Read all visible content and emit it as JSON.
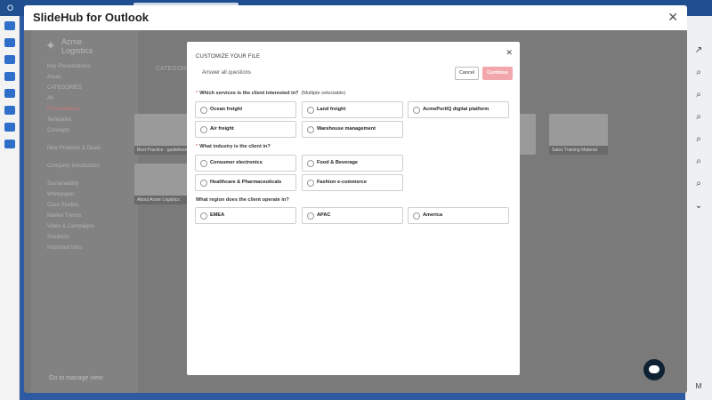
{
  "outlook": {
    "app_letter": "O"
  },
  "window": {
    "title": "SlideHub for Outlook"
  },
  "background": {
    "logo_line1": "Acme",
    "logo_line2": "Logistics",
    "categories_label": "CATEGORIES",
    "manage_view": "Go to manage view",
    "nav": [
      "Key Presentations",
      "Areas",
      "CATEGORIES",
      "All",
      "Presentations",
      "Templates",
      "Concepts",
      "New Products & Deals",
      "Company Introduction",
      "Sustainability",
      "Whitepaper",
      "Case Studies",
      "Market Trends",
      "Video & Campaigns",
      "Solutions",
      "Important links"
    ],
    "cards": [
      "Best Practice - guidelines",
      "About Acme Logistics",
      "Sales Training Material"
    ]
  },
  "modal": {
    "title": "CUSTOMIZE YOUR FILE",
    "answer_all": "Answer all questions",
    "cancel_label": "Cancel",
    "continue_label": "Continue",
    "q1": {
      "text": "Which services is the client interested in?",
      "note": "(Multiple selectable)",
      "options": [
        "Ocean freight",
        "Land freight",
        "AcmePortIQ digital platform",
        "Air freight",
        "Warehouse management"
      ]
    },
    "q2": {
      "text": "What industry is the client in?",
      "options": [
        "Consumer electronics",
        "Food & Beverage",
        "Healthcare & Pharmaceuticals",
        "Fashion e-commerce"
      ]
    },
    "q3": {
      "text": "What region does the client operate in?",
      "options": [
        "EMEA",
        "APAC",
        "America"
      ]
    }
  },
  "colors": {
    "accent": "#f2a7ad",
    "required": "#e0322f",
    "outlook_blue": "#1f4f8f"
  }
}
